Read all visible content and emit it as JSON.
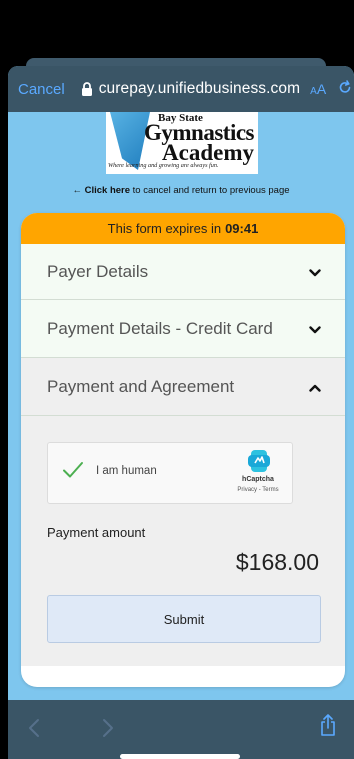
{
  "browser": {
    "cancel_label": "Cancel",
    "url": "curepay.unifiedbusiness.com",
    "text_size_label_small": "A",
    "text_size_label_big": "A"
  },
  "logo": {
    "line1": "Bay State",
    "line2": "Gymnastics",
    "line3": "Academy",
    "tagline": "Where learning and growing are always fun."
  },
  "backlink": {
    "link_text": "Click here",
    "rest_text": " to cancel and return to previous page"
  },
  "form": {
    "expiry_prefix": "This form expires in",
    "expiry_time": "09:41",
    "sections": [
      {
        "label": "Payer Details"
      },
      {
        "label": "Payment Details - Credit Card"
      },
      {
        "label": "Payment and Agreement"
      }
    ],
    "captcha": {
      "label": "I am human",
      "brand": "hCaptcha",
      "links": "Privacy - Terms"
    },
    "payment_label": "Payment amount",
    "payment_amount": "$168.00",
    "submit_label": "Submit"
  }
}
